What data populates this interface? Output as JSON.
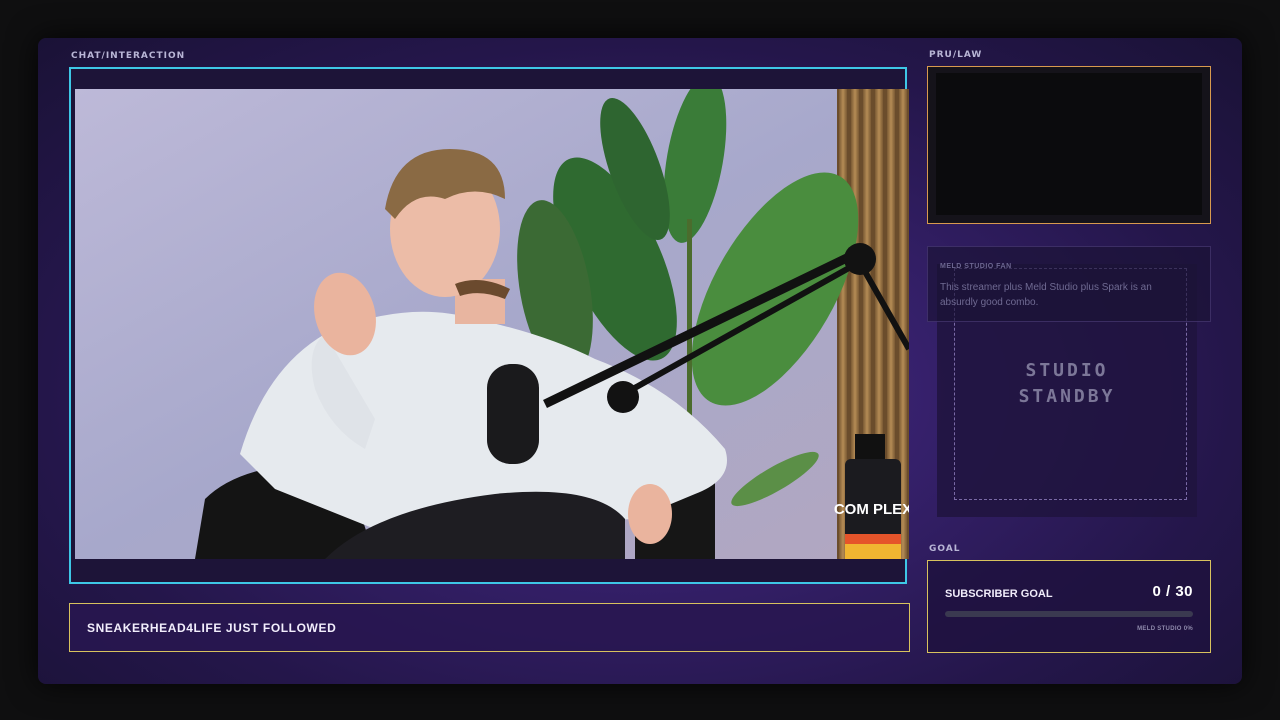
{
  "labels": {
    "chat": "CHAT/INTERACTION",
    "cam": "PRU/LAW",
    "goal": "GOAL"
  },
  "alert": {
    "text": "SNEAKERHEAD4LIFE JUST FOLLOWED"
  },
  "standby": {
    "line1": "STUDIO",
    "line2": "STANDBY"
  },
  "fan_card": {
    "title": "MELD STUDIO FAN",
    "message": "This streamer plus Meld Studio plus Spark is an absurdly good combo."
  },
  "goal": {
    "title": "SUBSCRIBER GOAL",
    "count": "0 / 30",
    "progress": 0,
    "footer": "MELD STUDIO 0%"
  },
  "video": {
    "bottle_label": "COM PLEX"
  },
  "colors": {
    "video_border": "#3ec7e6",
    "gold_border": "#d8c25e",
    "cam_border": "#d89a4e"
  }
}
